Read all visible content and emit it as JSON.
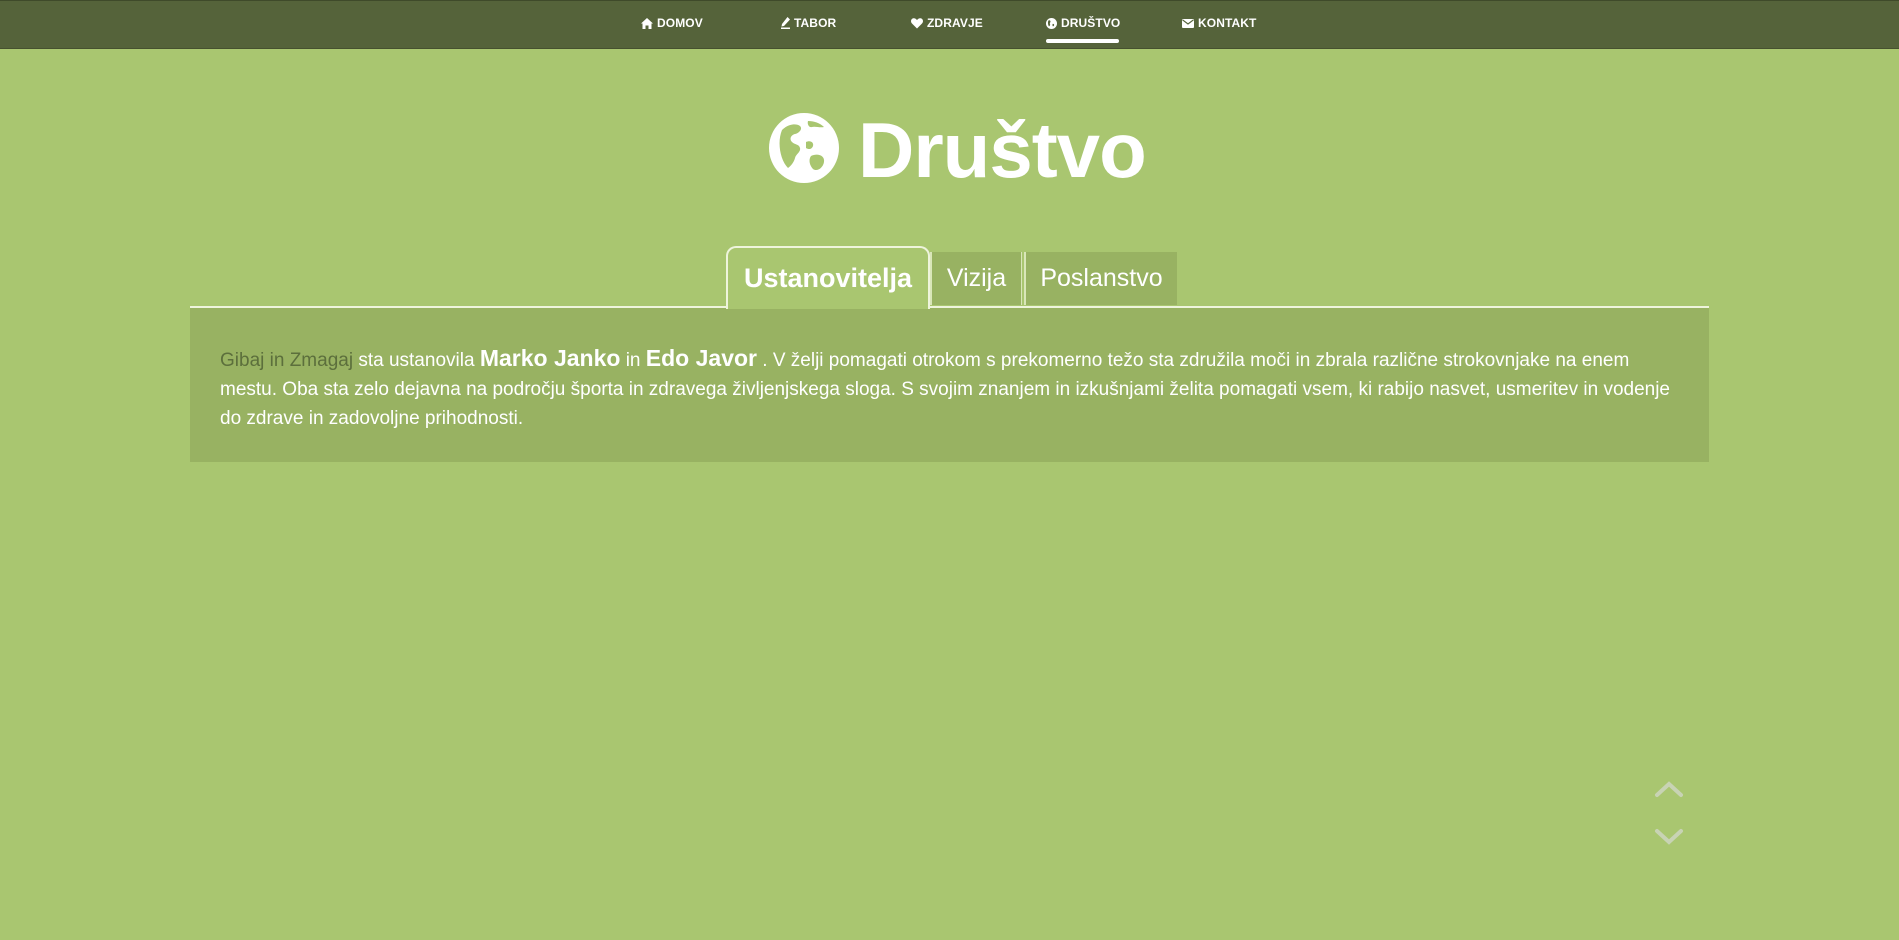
{
  "nav": {
    "items": [
      {
        "label": "DOMOV",
        "icon": "home-icon"
      },
      {
        "label": "TABOR",
        "icon": "pencil-icon"
      },
      {
        "label": "ZDRAVJE",
        "icon": "heart-icon"
      },
      {
        "label": "DRUŠTVO",
        "icon": "globe-icon",
        "active": true
      },
      {
        "label": "KONTAKT",
        "icon": "envelope-icon"
      }
    ]
  },
  "page": {
    "title": "Društvo",
    "title_icon": "globe-icon"
  },
  "tabs": [
    {
      "label": "Ustanovitelja",
      "active": true
    },
    {
      "label": "Vizija",
      "active": false
    },
    {
      "label": "Poslanstvo",
      "active": false
    }
  ],
  "content": {
    "brand": "Gibaj in Zmagaj",
    "text_1": " sta ustanovila ",
    "person_1": "Marko Janko",
    "text_2": " in ",
    "person_2": "Edo Javor",
    "text_3": " . V želji pomagati otrokom s prekomerno težo sta združila moči in zbrala različne strokovnjake na enem mestu. Oba sta zelo dejavna na področju športa in zdravega življenjskega sloga. S svojim znanjem in izkušnjami želita pomagati vsem, ki rabijo nasvet, usmeritev in vodenje do zdrave in zadovoljne prihodnosti."
  },
  "scroll": {
    "up_icon": "chevron-up-icon",
    "down_icon": "chevron-down-icon"
  },
  "colors": {
    "background": "#a9c670",
    "nav_bar": "#55633a",
    "content_box": "#98b262",
    "brand_text": "#5c6f3c",
    "text": "#ffffff"
  }
}
